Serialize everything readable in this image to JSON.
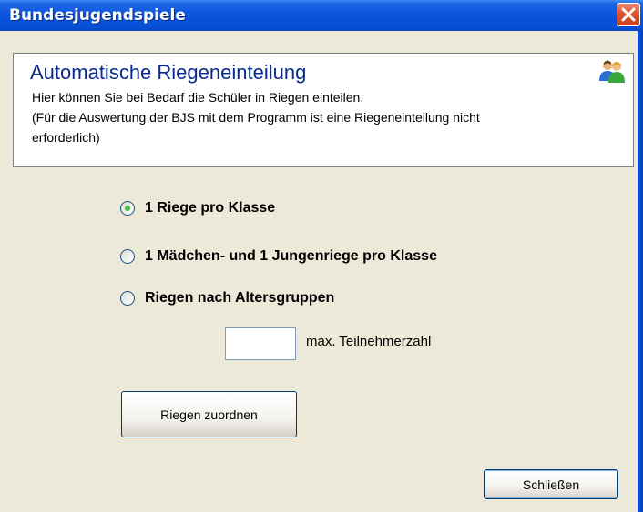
{
  "window": {
    "title": "Bundesjugendspiele",
    "close_icon": "close-icon"
  },
  "header": {
    "title": "Automatische Riegeneinteilung",
    "description_line1": "Hier können Sie bei Bedarf die Schüler in Riegen einteilen.",
    "description_line2": "(Für die Auswertung der BJS mit dem Programm ist eine Riegeneinteilung nicht",
    "description_line3": "erforderlich)",
    "icon": "users-icon"
  },
  "options": [
    {
      "label": "1 Riege pro Klasse",
      "checked": true
    },
    {
      "label": "1 Mädchen- und 1 Jungenriege pro Klasse",
      "checked": false
    },
    {
      "label": "Riegen nach Altersgruppen",
      "checked": false
    }
  ],
  "max_participants": {
    "value": "",
    "label": "max. Teilnehmerzahl"
  },
  "buttons": {
    "assign_label": "Riegen zuordnen",
    "close_label": "Schließen"
  },
  "colors": {
    "title_bar": "#0a55dc",
    "header_title": "#0a2a8c",
    "background": "#ece9d8",
    "close_button": "#e0552f"
  }
}
